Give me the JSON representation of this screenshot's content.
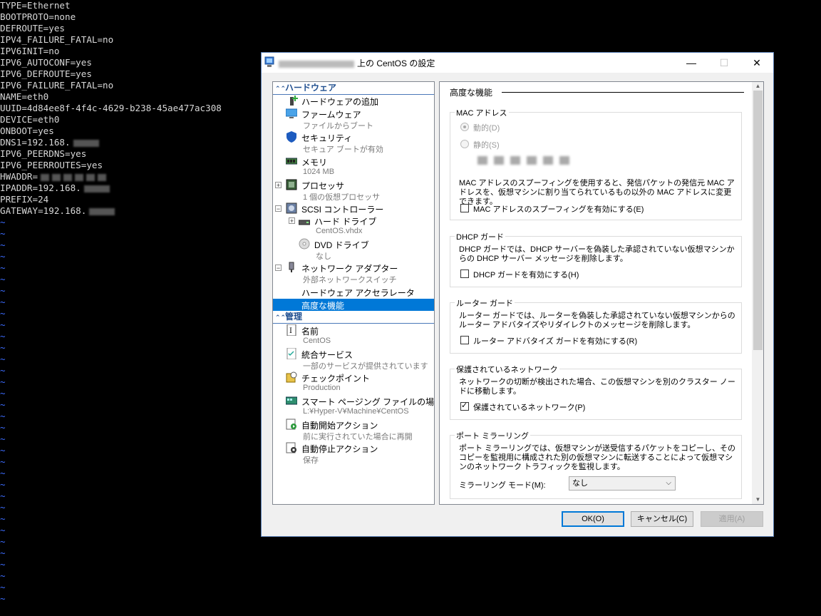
{
  "terminal": {
    "lines": [
      {
        "text": "TYPE=Ethernet"
      },
      {
        "text": "BOOTPROTO=none"
      },
      {
        "text": "DEFROUTE=yes"
      },
      {
        "text": "IPV4_FAILURE_FATAL=no"
      },
      {
        "text": "IPV6INIT=no"
      },
      {
        "text": "IPV6_AUTOCONF=yes"
      },
      {
        "text": "IPV6_DEFROUTE=yes"
      },
      {
        "text": "IPV6_FAILURE_FATAL=no"
      },
      {
        "text": "NAME=eth0"
      },
      {
        "text": "UUID=4d84ee8f-4f4c-4629-b238-45ae477ac308"
      },
      {
        "text": "DEVICE=eth0"
      },
      {
        "text": "ONBOOT=yes"
      },
      {
        "text": "DNS1=192.168."
      },
      {
        "text": "IPV6_PEERDNS=yes"
      },
      {
        "text": "IPV6_PEERROUTES=yes"
      },
      {
        "text": "HWADDR="
      },
      {
        "text": "IPADDR=192.168."
      },
      {
        "text": "PREFIX=24"
      },
      {
        "text": "GATEWAY=192.168."
      }
    ],
    "tilde": "~"
  },
  "dialog": {
    "title_suffix": "上の CentOS の設定",
    "minimize": "—",
    "maximize": "☐",
    "close": "✕"
  },
  "left": {
    "hardware_header": "ハードウェア",
    "management_header": "管理",
    "items": {
      "add_hw": {
        "main": "ハードウェアの追加"
      },
      "firmware": {
        "main": "ファームウェア",
        "sub": "ファイルからブート"
      },
      "security": {
        "main": "セキュリティ",
        "sub": "セキュア ブートが有効"
      },
      "memory": {
        "main": "メモリ",
        "sub": "1024 MB"
      },
      "processor": {
        "main": "プロセッサ",
        "sub": "1 個の仮想プロセッサ"
      },
      "scsi": {
        "main": "SCSI コントローラー"
      },
      "hdd": {
        "main": "ハード ドライブ",
        "sub": "CentOS.vhdx"
      },
      "dvd": {
        "main": "DVD ドライブ",
        "sub": "なし"
      },
      "nic": {
        "main": "ネットワーク アダプター",
        "sub": "外部ネットワークスイッチ"
      },
      "hwaccel": {
        "main": "ハードウェア アクセラレータ"
      },
      "advanced": {
        "main": "高度な機能"
      },
      "name": {
        "main": "名前",
        "sub": "CentOS"
      },
      "integration": {
        "main": "統合サービス",
        "sub": "一部のサービスが提供されています"
      },
      "checkpoint": {
        "main": "チェックポイント",
        "sub": "Production"
      },
      "paging": {
        "main": "スマート ページング ファイルの場所",
        "sub": "L:¥Hyper-V¥Machine¥CentOS"
      },
      "autostart": {
        "main": "自動開始アクション",
        "sub": "前に実行されていた場合に再開"
      },
      "autostop": {
        "main": "自動停止アクション",
        "sub": "保存"
      }
    }
  },
  "right": {
    "title": "高度な機能",
    "mac": {
      "label": "MAC アドレス",
      "dynamic": "動的(D)",
      "static": "静的(S)",
      "desc": "MAC アドレスのスプーフィングを使用すると、発信パケットの発信元 MAC アドレスを、仮想マシンに割り当てられているもの以外の MAC アドレスに変更できます。",
      "spoof_label": "MAC アドレスのスプーフィングを有効にする(E)",
      "spoof_checked": false
    },
    "dhcp": {
      "label": "DHCP ガード",
      "desc": "DHCP ガードでは、DHCP サーバーを偽装した承認されていない仮想マシンからの DHCP サーバー メッセージを削除します。",
      "check_label": "DHCP ガードを有効にする(H)",
      "checked": false
    },
    "router": {
      "label": "ルーター ガード",
      "desc": "ルーター ガードでは、ルーターを偽装した承認されていない仮想マシンからのルーター アドバタイズやリダイレクトのメッセージを削除します。",
      "check_label": "ルーター アドバタイズ ガードを有効にする(R)",
      "checked": false
    },
    "protected": {
      "label": "保護されているネットワーク",
      "desc": "ネットワークの切断が検出された場合、この仮想マシンを別のクラスター ノードに移動します。",
      "check_label": "保護されているネットワーク(P)",
      "checked": true
    },
    "mirror": {
      "label": "ポート ミラーリング",
      "desc": "ポート ミラーリングでは、仮想マシンが送受信するパケットをコピーし、そのコピーを監視用に構成された別の仮想マシンに転送することによって仮想マシンのネットワーク トラフィックを監視します。",
      "mode_label": "ミラーリング モード(M):",
      "mode_value": "なし"
    }
  },
  "buttons": {
    "ok": "OK(O)",
    "cancel": "キャンセル(C)",
    "apply": "適用(A)"
  }
}
